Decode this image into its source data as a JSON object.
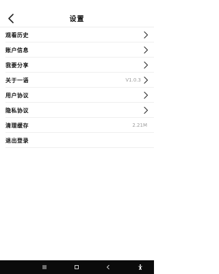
{
  "header": {
    "title": "设置"
  },
  "settings": {
    "items": [
      {
        "label": "观看历史",
        "value": null,
        "chevron": true
      },
      {
        "label": "账户信息",
        "value": null,
        "chevron": true
      },
      {
        "label": "我要分享",
        "value": null,
        "chevron": true
      },
      {
        "label": "关于一语",
        "value": "V1.0.3",
        "chevron": true
      },
      {
        "label": "用户协议",
        "value": null,
        "chevron": true
      },
      {
        "label": "隐私协议",
        "value": null,
        "chevron": true
      },
      {
        "label": "清理缓存",
        "value": "2.21M",
        "chevron": false
      },
      {
        "label": "退出登录",
        "value": null,
        "chevron": false
      }
    ]
  },
  "icons": {
    "back": "chevron-left-icon",
    "row": "chevron-right-icon",
    "nav": [
      "menu-icon",
      "square-icon",
      "back-triangle-icon",
      "accessibility-icon"
    ]
  },
  "colors": {
    "value_text": "#9a9a9a",
    "divider": "#efefef",
    "navbar": "#0b0b0b"
  }
}
